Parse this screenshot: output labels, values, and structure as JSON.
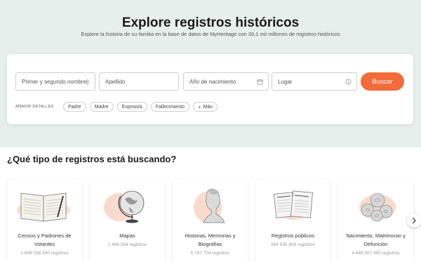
{
  "hero": {
    "title": "Explore registros históricos",
    "subtitle": "Explore la historia de su familia en la base de datos de MyHeritage con 39,1 mil millones de registros históricos"
  },
  "search": {
    "first_name_placeholder": "Primer y segundo nombre(s)",
    "last_name_placeholder": "Apellido",
    "birth_year_placeholder": "Año de nacimiento",
    "place_placeholder": "Lugar",
    "search_label": "Buscar",
    "details_label": "AÑADIR DETALLES",
    "chips": [
      "Padre",
      "Madre",
      "Esposo/a",
      "Fallecimiento",
      "Más"
    ]
  },
  "categories": {
    "title": "¿Qué tipo de registros está buscando?",
    "items": [
      {
        "title": "Censos y Padrones de Votantes",
        "count": "1 609 038 340 registros",
        "icon": "census-book-icon"
      },
      {
        "title": "Mapas",
        "count": "1 466 594 registros",
        "icon": "globe-icon"
      },
      {
        "title": "Historias, Memorias y Biografías",
        "count": "5 787 704 registros",
        "icon": "bust-statue-icon"
      },
      {
        "title": "Registros públicos",
        "count": "264 535 909 registros",
        "icon": "newspapers-icon"
      },
      {
        "title": "Nacimiento, Matrimonio y Defunción",
        "count": "4 649 007 895 registros",
        "icon": "roses-icon"
      }
    ]
  },
  "colors": {
    "accent": "#f26b3a",
    "hero_bg": "#e6efeb",
    "blob": "#f8d2c0"
  }
}
